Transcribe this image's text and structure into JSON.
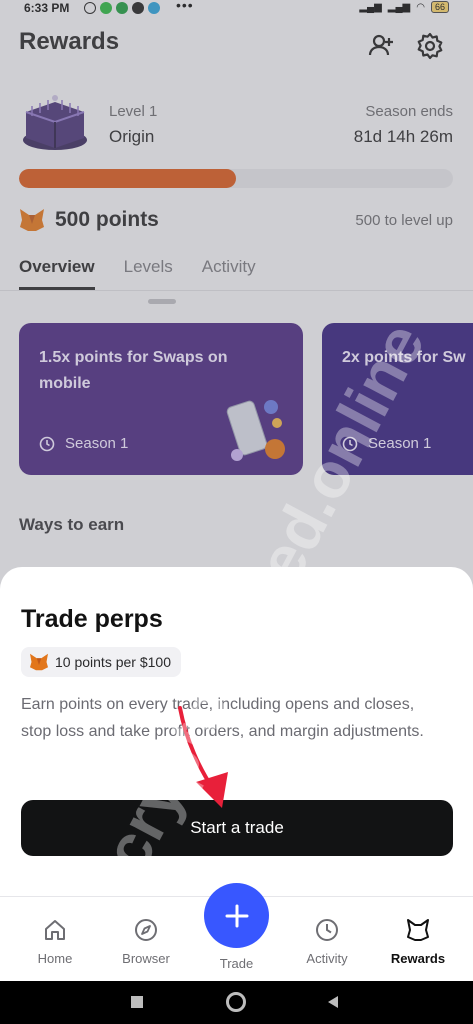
{
  "status_bar": {
    "time": "6:33 PM",
    "battery": "66"
  },
  "header": {
    "title": "Rewards",
    "add_user_icon": "add-user-icon",
    "settings_icon": "gear-icon"
  },
  "level": {
    "label": "Level 1",
    "name": "Origin",
    "season_label": "Season ends",
    "season_remaining": "81d 14h 26m",
    "progress_fraction": 0.5
  },
  "points": {
    "value": "500 points",
    "to_level": "500 to level up"
  },
  "tabs": [
    {
      "label": "Overview",
      "active": true
    },
    {
      "label": "Levels",
      "active": false
    },
    {
      "label": "Activity",
      "active": false
    }
  ],
  "cards": [
    {
      "title": "1.5x points for Swaps on mobile",
      "season": "Season 1",
      "color": "#4c2a82"
    },
    {
      "title": "2x points for Sw",
      "season": "Season 1",
      "color": "#35207e"
    }
  ],
  "ways_title": "Ways to earn",
  "sheet": {
    "title": "Trade perps",
    "badge": "10 points per $100",
    "description": "Earn points on every trade, including opens and closes, stop loss and take profit orders, and margin adjustments.",
    "cta": "Start a trade"
  },
  "nav": [
    {
      "label": "Home",
      "icon": "home-icon"
    },
    {
      "label": "Browser",
      "icon": "compass-icon"
    },
    {
      "label": "Trade",
      "icon": "plus-icon"
    },
    {
      "label": "Activity",
      "icon": "clock-icon"
    },
    {
      "label": "Rewards",
      "icon": "fox-icon"
    }
  ],
  "watermark": "cryptoahmed.online",
  "colors": {
    "accent": "#3857ff",
    "progress": "#d8591c",
    "fox": "#e2761b"
  }
}
